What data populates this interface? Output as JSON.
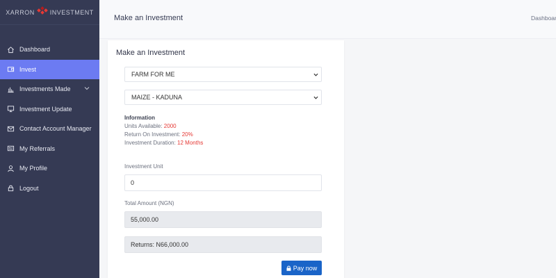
{
  "brand": {
    "name_left": "XARRON",
    "name_right": "INVESTMENT"
  },
  "sidebar": {
    "items": [
      {
        "label": "Dashboard",
        "icon": "home-icon",
        "active": false
      },
      {
        "label": "Invest",
        "icon": "wallet-icon",
        "active": true
      },
      {
        "label": "Investments Made",
        "icon": "bar-chart-icon",
        "active": false,
        "has_chevron": true
      },
      {
        "label": "Investment Update",
        "icon": "monitor-icon",
        "active": false
      },
      {
        "label": "Contact Account Manager",
        "icon": "mail-icon",
        "active": false
      },
      {
        "label": "My Referrals",
        "icon": "newspaper-icon",
        "active": false
      },
      {
        "label": "My Profile",
        "icon": "user-icon",
        "active": false
      },
      {
        "label": "Logout",
        "icon": "lock-icon",
        "active": false
      }
    ]
  },
  "header": {
    "title": "Make an Investment",
    "breadcrumb": "Dashboard"
  },
  "form": {
    "title": "Make an Investment",
    "scheme_select": "FARM FOR ME",
    "product_select": "MAIZE - KADUNA",
    "info_heading": "Information",
    "units_label": "Units Available:",
    "units_value": "2000",
    "roi_label": "Return On Investment:",
    "roi_value": "20%",
    "duration_label": "Investment Duration:",
    "duration_value": "12 Months",
    "unit_label": "Investment Unit",
    "unit_value": "0",
    "total_label": "Total Amount (NGN)",
    "total_value": "55,000.00",
    "returns_value": "Returns: N66,000.00",
    "pay_label": "Pay now"
  },
  "colors": {
    "sidebar_bg": "#353a54",
    "active_item": "#6c7bf2",
    "primary_button": "#1a64c8",
    "highlight_value": "#e53935"
  }
}
